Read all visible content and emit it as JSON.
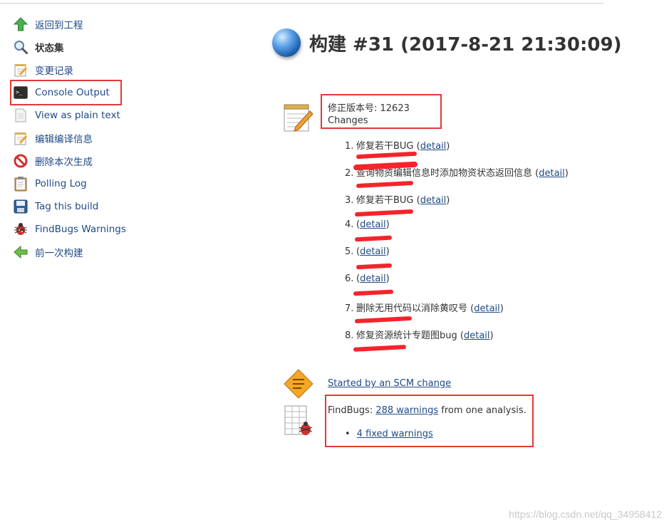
{
  "sidebar": {
    "items": [
      {
        "label": "返回到工程",
        "icon": "up-arrow-icon"
      },
      {
        "label": "状态集",
        "icon": "search-icon"
      },
      {
        "label": "变更记录",
        "icon": "notepad-icon"
      },
      {
        "label": "Console Output",
        "icon": "terminal-icon"
      },
      {
        "label": "View as plain text",
        "icon": "document-icon"
      },
      {
        "label": "编辑编译信息",
        "icon": "notepad-icon"
      },
      {
        "label": "删除本次生成",
        "icon": "no-entry-icon"
      },
      {
        "label": "Polling Log",
        "icon": "clipboard-icon"
      },
      {
        "label": "Tag this build",
        "icon": "floppy-icon"
      },
      {
        "label": "FindBugs Warnings",
        "icon": "bug-icon"
      },
      {
        "label": "前一次构建",
        "icon": "left-arrow-icon"
      }
    ]
  },
  "header": {
    "title": "构建 #31 (2017-8-21 21:30:09)"
  },
  "revision": {
    "label": "修正版本号: 12623",
    "changes_label": "Changes"
  },
  "changes": [
    {
      "num": "1.",
      "text": "修复若干BUG ",
      "detail": "detail"
    },
    {
      "num": "2.",
      "text": "查询物资编辑信息时添加物资状态返回信息 ",
      "detail": "detail"
    },
    {
      "num": "3.",
      "text": "修复若干BUG ",
      "detail": "detail"
    },
    {
      "num": "4.",
      "text": "",
      "detail": "detail"
    },
    {
      "num": "5.",
      "text": "",
      "detail": "detail"
    },
    {
      "num": "6.",
      "text": "",
      "detail": "detail"
    },
    {
      "num": "7.",
      "text": "删除无用代码以消除黄叹号 ",
      "detail": "detail"
    },
    {
      "num": "8.",
      "text": "修复资源统计专题图bug ",
      "detail": "detail"
    }
  ],
  "started": {
    "link": "Started by an SCM change"
  },
  "findbugs": {
    "prefix": "FindBugs: ",
    "link": "288 warnings",
    "suffix": " from one analysis.",
    "fixed_link": "4 fixed warnings"
  },
  "watermark": "https://blog.csdn.net/qq_34958412",
  "colors": {
    "link": "#204a87",
    "highlight_box": "#e53935",
    "scribble": "#f4242a"
  }
}
